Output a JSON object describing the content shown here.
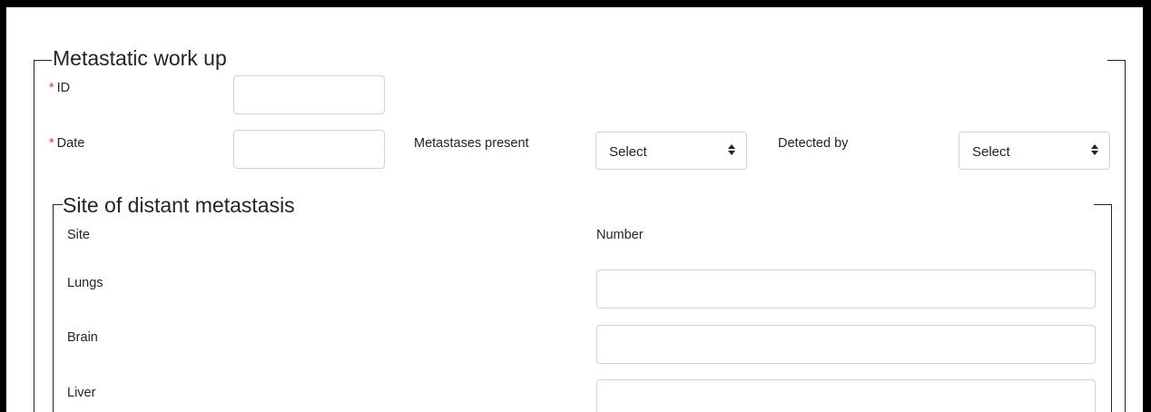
{
  "metastatic": {
    "legend": "Metastatic work up",
    "id_label": "ID",
    "date_label": "Date",
    "required_mark": "*",
    "metastases_label": "Metastases present",
    "metastases_value": "Select",
    "detected_label": "Detected by",
    "detected_value": "Select"
  },
  "site_section": {
    "legend": "Site of distant metastasis",
    "site_header": "Site",
    "number_header": "Number",
    "rows": [
      {
        "label": "Lungs"
      },
      {
        "label": "Brain"
      },
      {
        "label": "Liver"
      }
    ]
  }
}
